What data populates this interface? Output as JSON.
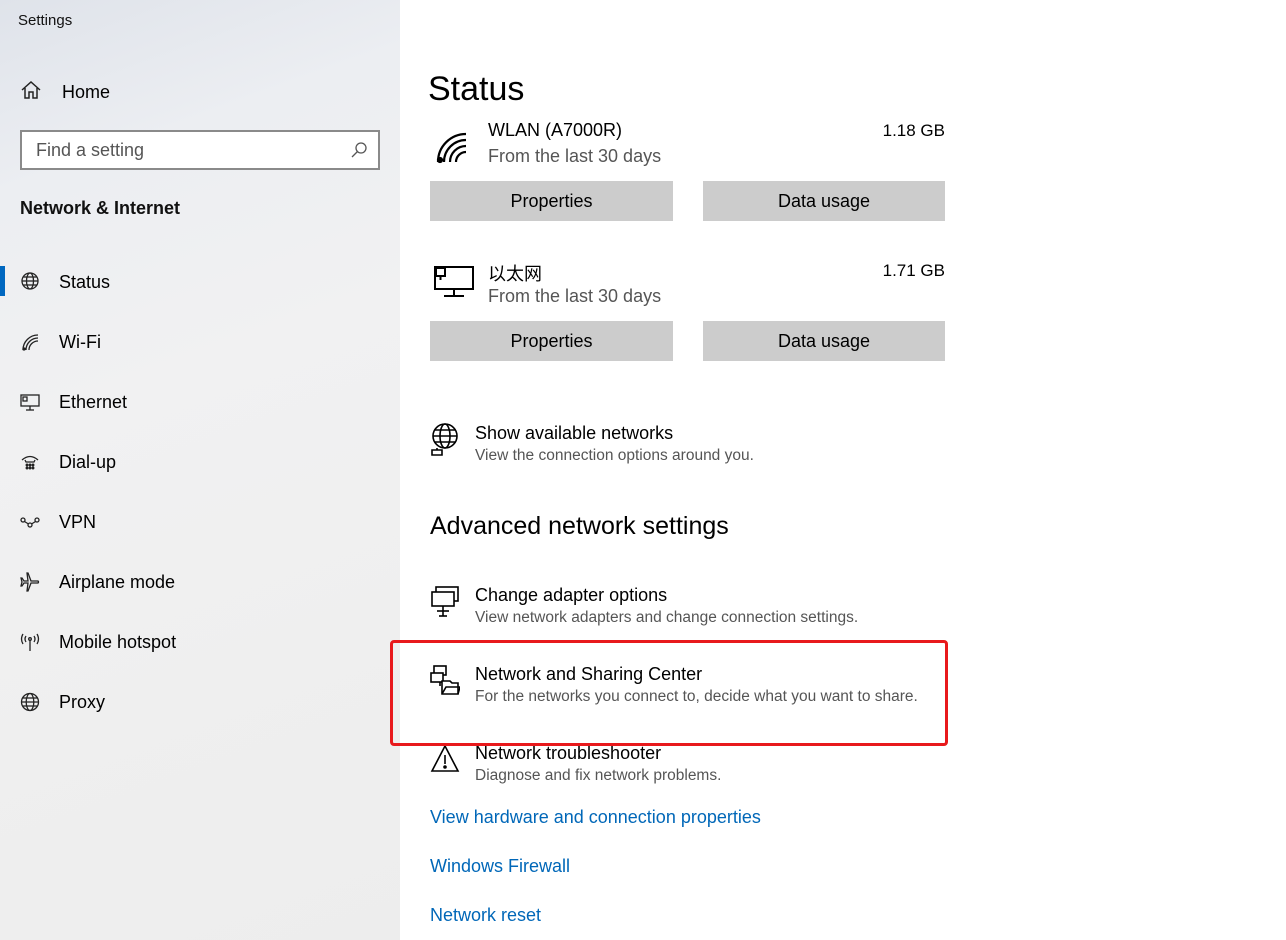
{
  "app": {
    "title": "Settings"
  },
  "sidebar": {
    "home_label": "Home",
    "search_placeholder": "Find a setting",
    "section_title": "Network & Internet",
    "items": [
      {
        "label": "Status",
        "icon": "globe-network-icon",
        "active": true
      },
      {
        "label": "Wi-Fi",
        "icon": "wifi-icon"
      },
      {
        "label": "Ethernet",
        "icon": "ethernet-icon"
      },
      {
        "label": "Dial-up",
        "icon": "dialup-icon"
      },
      {
        "label": "VPN",
        "icon": "vpn-icon"
      },
      {
        "label": "Airplane mode",
        "icon": "airplane-icon"
      },
      {
        "label": "Mobile hotspot",
        "icon": "hotspot-icon"
      },
      {
        "label": "Proxy",
        "icon": "globe-icon"
      }
    ]
  },
  "main": {
    "title": "Status",
    "networks": [
      {
        "name": "WLAN (A7000R)",
        "sub": "From the last 30 days",
        "size": "1.18 GB",
        "icon": "wifi-signal-icon",
        "properties_label": "Properties",
        "usage_label": "Data usage"
      },
      {
        "name": "以太网",
        "sub": "From the last 30 days",
        "size": "1.71 GB",
        "icon": "ethernet-pc-icon",
        "properties_label": "Properties",
        "usage_label": "Data usage"
      }
    ],
    "show_networks": {
      "title": "Show available networks",
      "desc": "View the connection options around you.",
      "icon": "globe-network-icon"
    },
    "advanced_title": "Advanced network settings",
    "advanced": [
      {
        "title": "Change adapter options",
        "desc": "View network adapters and change connection settings.",
        "icon": "adapter-icon"
      },
      {
        "title": "Network and Sharing Center",
        "desc": "For the networks you connect to, decide what you want to share.",
        "icon": "sharing-center-icon"
      },
      {
        "title": "Network troubleshooter",
        "desc": "Diagnose and fix network problems.",
        "icon": "warning-icon"
      }
    ],
    "links": [
      "View hardware and connection properties",
      "Windows Firewall",
      "Network reset"
    ]
  },
  "colors": {
    "accent": "#0067c0",
    "link": "#0067b8",
    "highlight": "#e8191c",
    "button": "#cccccc"
  }
}
